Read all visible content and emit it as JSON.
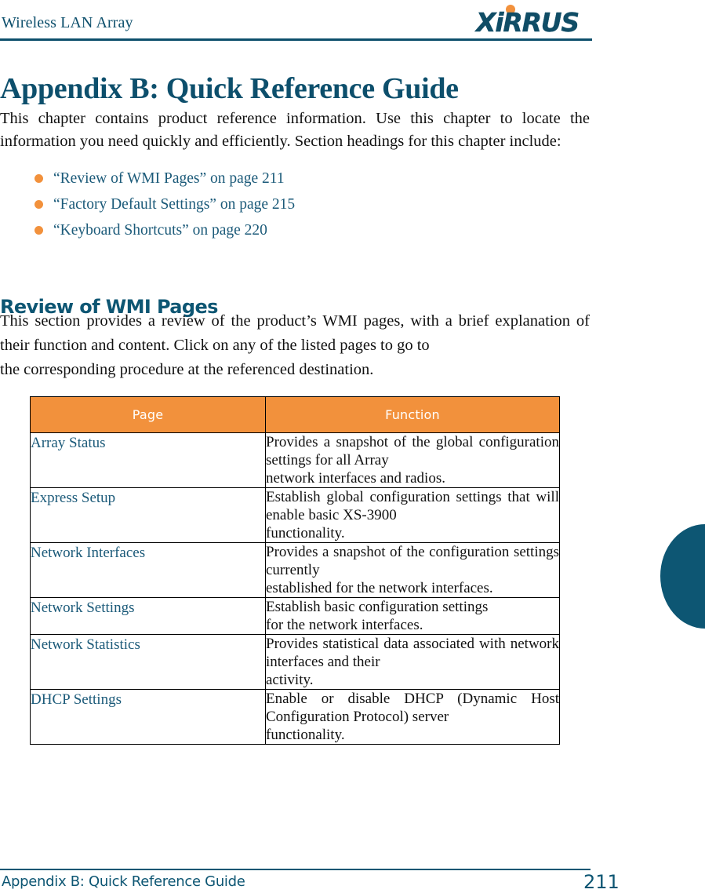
{
  "header": {
    "running_head": "Wireless LAN Array",
    "logo_text": "XiRRUS",
    "logo_dot_color": "#f2913c",
    "logo_text_color": "#104d66",
    "rule_color": "#0d4f6c"
  },
  "chapter": {
    "title": "Appendix B: Quick Reference Guide",
    "intro": "This chapter contains product reference information. Use this chapter to locate the information you need quickly and efficiently. Section headings for this chapter include:",
    "bullets": [
      "“Review of WMI Pages” on page 211",
      "“Factory Default Settings” on page 215",
      "“Keyboard Shortcuts” on page 220"
    ]
  },
  "section": {
    "heading": "Review of WMI Pages",
    "paragraph_justified": "This section provides a review of the product’s WMI pages, with a brief explanation of their function and content. Click on any of the listed pages to go to",
    "paragraph_last_line": "the corresponding procedure at the referenced destination."
  },
  "table": {
    "header_bg": "#f2913c",
    "header_text_color": "#ffffff",
    "link_color": "#1b5a79",
    "columns": [
      "Page",
      "Function"
    ],
    "rows": [
      {
        "page": "Array Status",
        "function": "Provides a snapshot of the global configuration settings for all Array",
        "function_last": "network interfaces and radios."
      },
      {
        "page": "Express Setup",
        "function": "Establish global configuration settings that will enable basic XS-3900",
        "function_last": "functionality."
      },
      {
        "page": "Network Interfaces",
        "function": "Provides a snapshot of the configuration settings currently",
        "function_last": "established for the network interfaces."
      },
      {
        "page": "Network Settings",
        "function": "Establish basic configuration settings",
        "function_last": "for the network interfaces."
      },
      {
        "page": "Network Statistics",
        "function": "Provides statistical data associated with network interfaces and their",
        "function_last": "activity."
      },
      {
        "page": "DHCP Settings",
        "function": "Enable or disable DHCP (Dynamic Host Configuration Protocol) server",
        "function_last": "functionality."
      }
    ]
  },
  "thumb_tab": {
    "color": "#0d5673"
  },
  "footer": {
    "left": "Appendix B: Quick Reference Guide",
    "page_number": "211",
    "rule_color": "#0d5673"
  }
}
